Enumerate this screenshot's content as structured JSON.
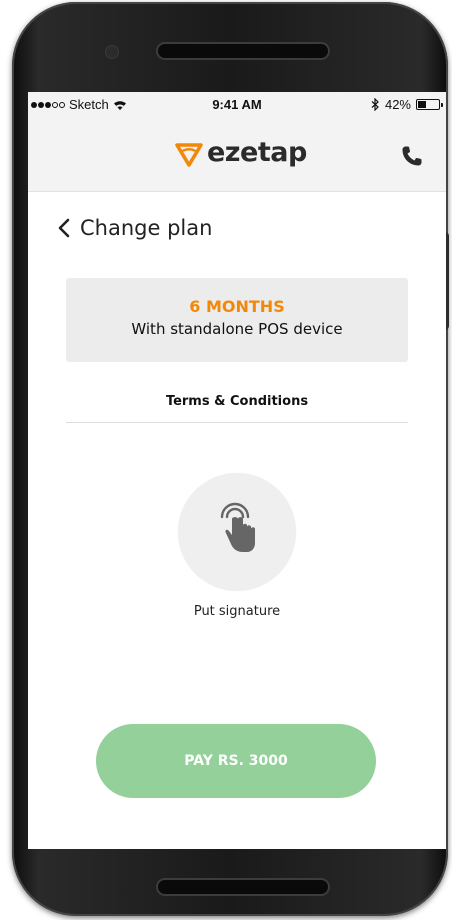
{
  "status_bar": {
    "carrier": "Sketch",
    "time": "9:41 AM",
    "battery": "42%",
    "battery_level": 0.42
  },
  "header": {
    "logo_text": "ezetap",
    "brand_color": "#f2880a",
    "call_icon": "phone-icon"
  },
  "nav": {
    "back_label": "Change plan"
  },
  "plan": {
    "duration": "6 MONTHS",
    "description": "With standalone POS device",
    "accent_color": "#f2880a"
  },
  "terms": {
    "label": "Terms & Conditions"
  },
  "signature": {
    "icon": "touch-icon",
    "label": "Put signature"
  },
  "pay": {
    "label": "PAY RS. 3000",
    "color": "#94d09a"
  }
}
